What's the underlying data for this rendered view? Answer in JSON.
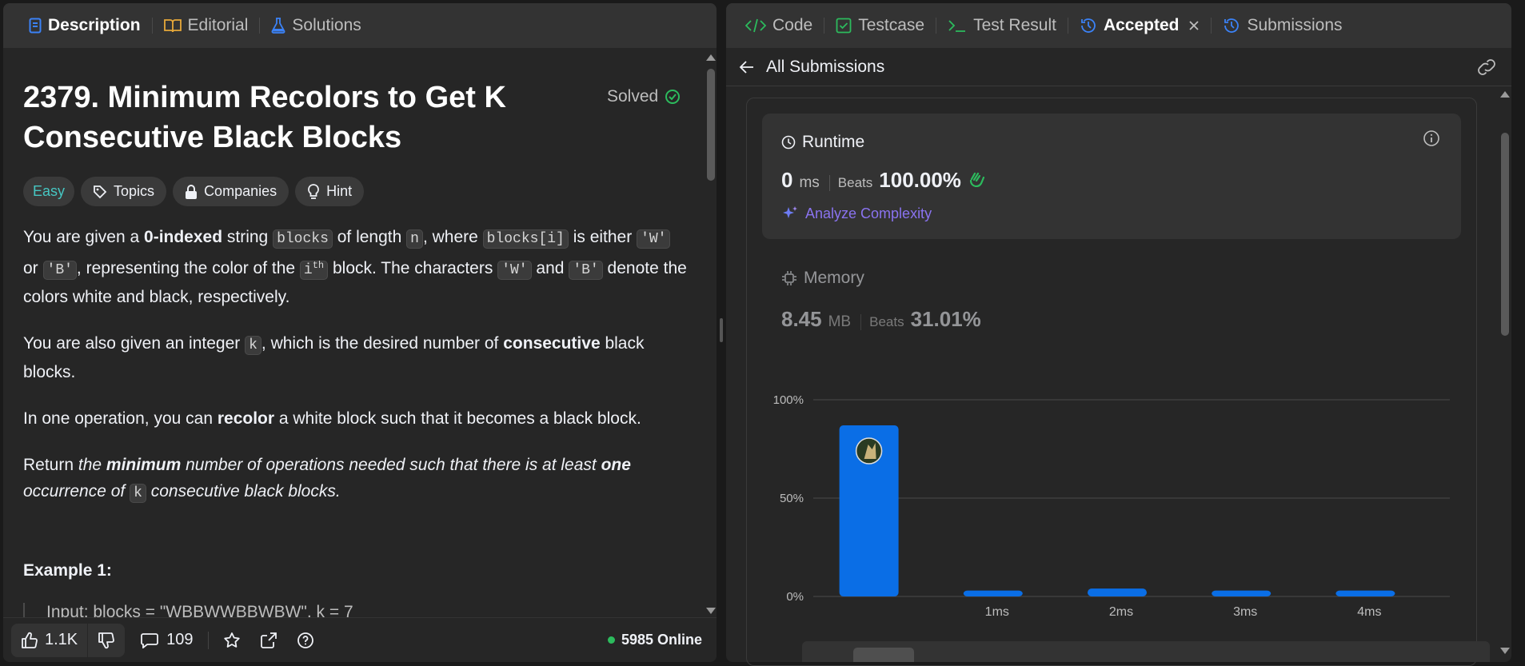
{
  "left": {
    "tabs": [
      {
        "label": "Description",
        "icon": "description-icon"
      },
      {
        "label": "Editorial",
        "icon": "book-icon"
      },
      {
        "label": "Solutions",
        "icon": "flask-icon"
      }
    ],
    "title": "2379. Minimum Recolors to Get K Consecutive Black Blocks",
    "solved_label": "Solved",
    "tags": {
      "difficulty": "Easy",
      "topics": "Topics",
      "companies": "Companies",
      "hint": "Hint"
    },
    "description": {
      "p1": {
        "t1": "You are given a ",
        "b1": "0-indexed",
        "t2": " string ",
        "c1": "blocks",
        "t3": " of length ",
        "c2": "n",
        "t4": ", where ",
        "c3": "blocks[i]",
        "t5": " is either ",
        "c4": "'W'",
        "t6": " or ",
        "c5": "'B'",
        "t7": ", representing the color of the ",
        "c6": "i",
        "sup": "th",
        "t8": " block. The characters ",
        "c7": "'W'",
        "t9": " and ",
        "c8": "'B'",
        "t10": " denote the colors white and black, respectively."
      },
      "p2": {
        "t1": "You are also given an integer ",
        "c1": "k",
        "t2": ", which is the desired number of ",
        "b1": "consecutive",
        "t3": " black blocks."
      },
      "p3": {
        "t1": "In one operation, you can ",
        "b1": "recolor",
        "t2": " a white block such that it becomes a black block."
      },
      "p4": {
        "t1": "Return ",
        "i1": "the ",
        "b1": "minimum",
        "i2": " number of operations needed such that there is at least ",
        "b2": "one",
        "i3": " occurrence of ",
        "c1": "k",
        "i4": " consecutive black blocks."
      }
    },
    "example_title": "Example 1:",
    "example_cut": "Input: blocks = \"WBBWWBBWBW\", k = 7",
    "footer": {
      "likes": "1.1K",
      "comments": "109",
      "online": "5985 Online"
    }
  },
  "right": {
    "tabs": [
      {
        "label": "Code",
        "icon": "code-icon"
      },
      {
        "label": "Testcase",
        "icon": "check-square-icon"
      },
      {
        "label": "Test Result",
        "icon": "terminal-icon"
      },
      {
        "label": "Accepted",
        "icon": "history-icon"
      },
      {
        "label": "Submissions",
        "icon": "history-icon"
      }
    ],
    "back_label": "All Submissions",
    "runtime": {
      "label": "Runtime",
      "value": "0",
      "unit": "ms",
      "beats_label": "Beats",
      "beats_value": "100.00%",
      "analyze": "Analyze Complexity"
    },
    "memory": {
      "label": "Memory",
      "value": "8.45",
      "unit": "MB",
      "beats_label": "Beats",
      "beats_value": "31.01%"
    }
  },
  "colors": {
    "bar": "#0a6ee6",
    "accent_green": "#2cbb5d",
    "easy": "#46c6c2",
    "analyze": "#8a73f0"
  },
  "chart_data": {
    "type": "bar",
    "categories": [
      "0ms",
      "1ms",
      "2ms",
      "3ms",
      "4ms"
    ],
    "category_labels": [
      "",
      "1ms",
      "2ms",
      "3ms",
      "4ms"
    ],
    "values": [
      87,
      3,
      4,
      3,
      3
    ],
    "ylim": [
      0,
      100
    ],
    "yticks": [
      "0%",
      "50%",
      "100%"
    ],
    "grid": true,
    "highlighted_category": "0ms"
  }
}
